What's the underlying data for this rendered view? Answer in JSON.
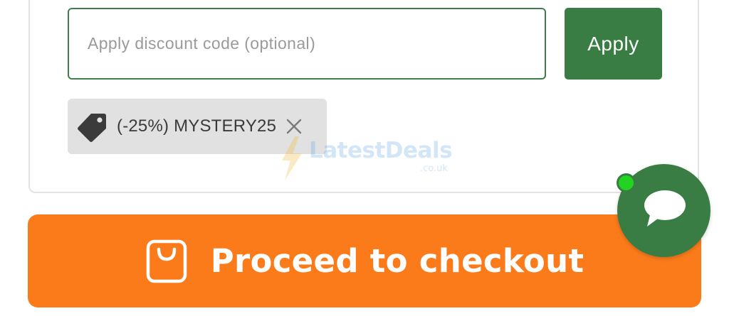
{
  "discount": {
    "placeholder": "Apply discount code (optional)",
    "value": "",
    "apply_label": "Apply"
  },
  "coupon": {
    "label": "(-25%) MYSTERY25",
    "tag_icon": "price-tag-icon",
    "remove_icon": "close-icon"
  },
  "watermark": {
    "name": "LatestDeals",
    "domain": ".co.uk"
  },
  "checkout": {
    "label": "Proceed to checkout",
    "icon": "shopping-bag-icon"
  },
  "chat": {
    "icon": "chat-bubble-icon",
    "online": true
  },
  "colors": {
    "brand_green": "#3a7d44",
    "checkout_orange": "#fb7b1b",
    "online_green": "#22d322",
    "coupon_bg": "#e1e1e1"
  }
}
